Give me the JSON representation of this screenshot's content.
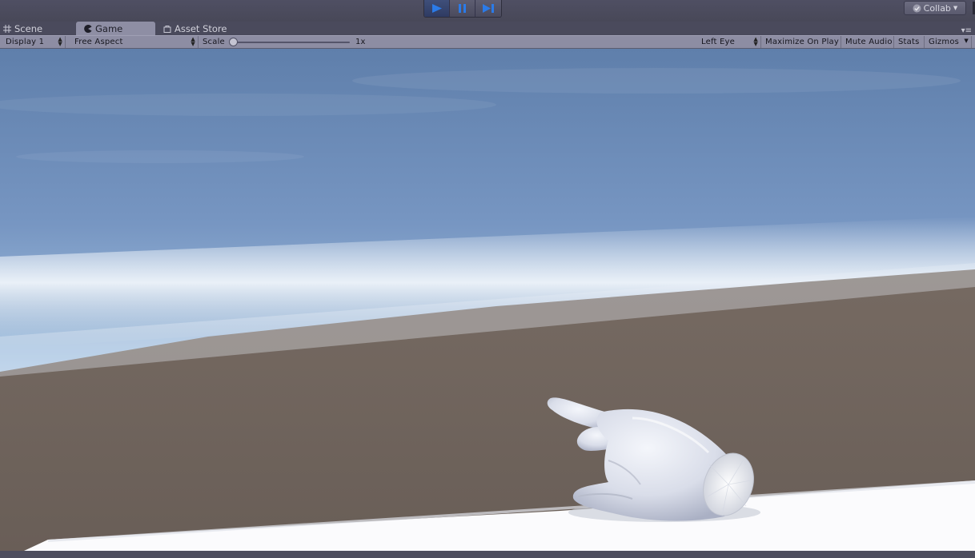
{
  "top_bar": {
    "play_buttons": [
      {
        "name": "play-button",
        "icon": "play-icon",
        "active": true
      },
      {
        "name": "pause-button",
        "icon": "pause-icon",
        "active": false
      },
      {
        "name": "step-button",
        "icon": "step-icon",
        "active": false
      }
    ],
    "collab_label": "Collab"
  },
  "tabs": [
    {
      "label": "Scene",
      "icon": "grid-icon"
    },
    {
      "label": "Game",
      "icon": "pacman-icon",
      "active": true
    },
    {
      "label": "Asset Store",
      "icon": "bag-icon"
    }
  ],
  "game_toolbar": {
    "display": "Display 1",
    "aspect": "Free Aspect",
    "scale_label": "Scale",
    "scale_value": "1x",
    "scale_fraction": 0.0,
    "eye": "Left Eye",
    "maximize": "Maximize On Play",
    "mute": "Mute Audio",
    "stats": "Stats",
    "gizmos": "Gizmos"
  },
  "colors": {
    "sky_top": "#5f81ae",
    "horizon": "#f2f7fb",
    "ground": "#6d625b",
    "accent_blue": "#2b6fe0"
  }
}
